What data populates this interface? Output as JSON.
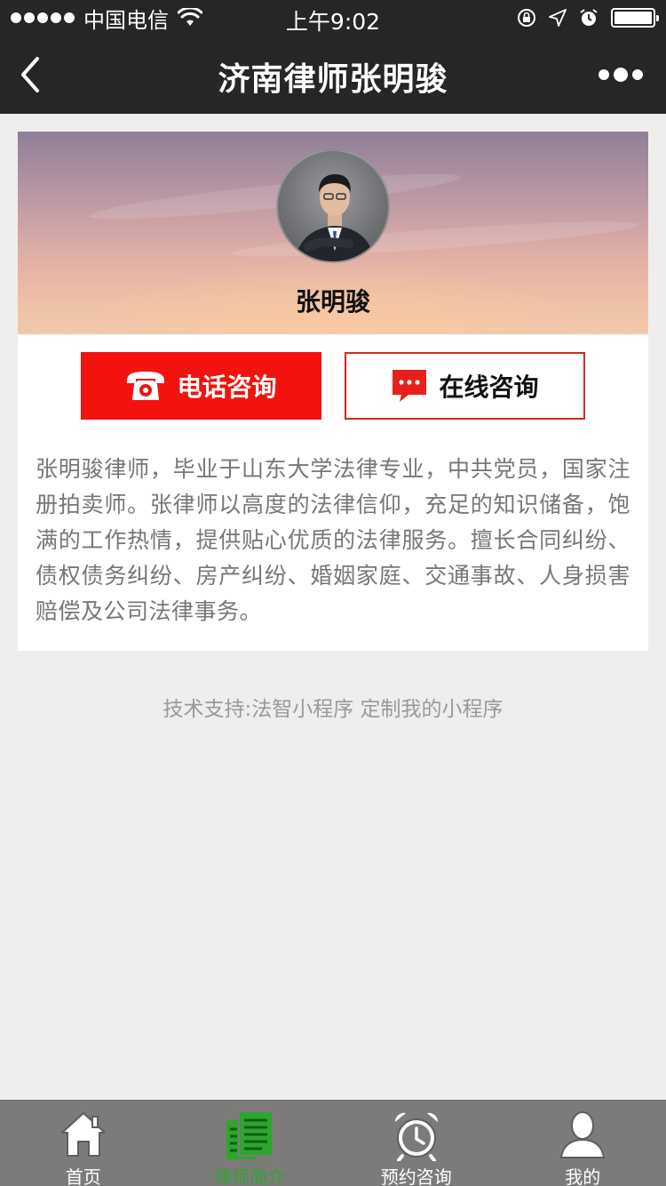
{
  "status_bar": {
    "carrier": "中国电信",
    "time": "上午9:02"
  },
  "nav": {
    "title": "济南律师张明骏"
  },
  "profile": {
    "name": "张明骏"
  },
  "actions": {
    "phone_label": "电话咨询",
    "online_label": "在线咨询"
  },
  "bio": "张明骏律师，毕业于山东大学法律专业，中共党员，国家注册拍卖师。张律师以高度的法律信仰，充足的知识储备，饱满的工作热情，提供贴心优质的法律服务。擅长合同纠纷、债权债务纠纷、房产纠纷、婚姻家庭、交通事故、人身损害赔偿及公司法律事务。",
  "support": {
    "prefix": "技术支持:法智小程序",
    "link": "定制我的小程序"
  },
  "tabs": [
    {
      "label": "首页",
      "icon": "home-icon",
      "active": false
    },
    {
      "label": "律师简介",
      "icon": "document-icon",
      "active": true
    },
    {
      "label": "预约咨询",
      "icon": "alarm-clock-icon",
      "active": false
    },
    {
      "label": "我的",
      "icon": "user-icon",
      "active": false
    }
  ],
  "colors": {
    "nav_bg": "#262626",
    "phone_button": "#f2130f",
    "online_border": "#d7261e",
    "tab_active": "#2ea52f",
    "tabbar_bg": "#7c7b7a"
  }
}
